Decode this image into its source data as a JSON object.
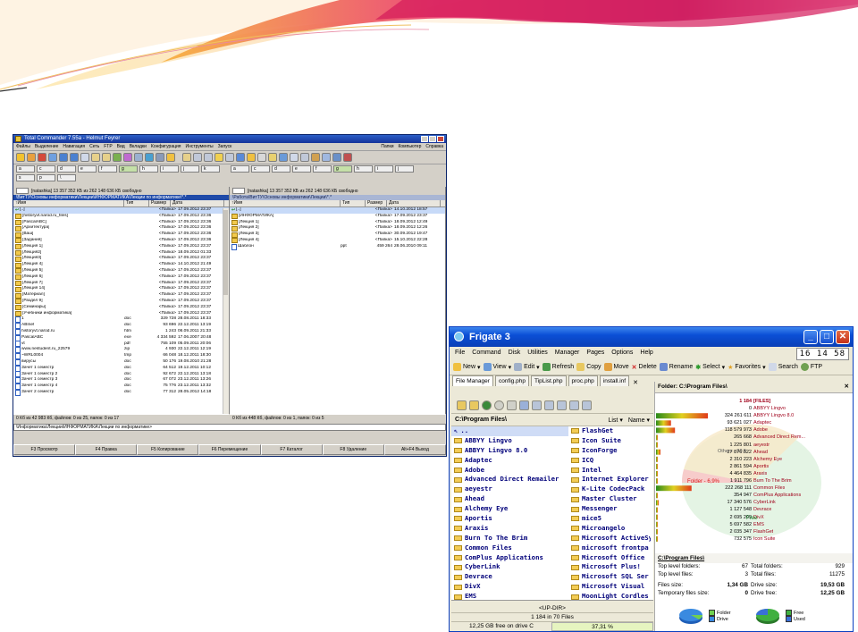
{
  "total_commander": {
    "title": "Total Commander 7.55a - Helmut Feyrer",
    "menu": [
      "Файлы",
      "Выделение",
      "Навигация",
      "Сеть",
      "FTP",
      "Вид",
      "Вкладки",
      "Конфигурация",
      "Инструменты",
      "Запуск"
    ],
    "menu_right": [
      "Папки",
      "Компьютер",
      "Справка"
    ],
    "left_panel": {
      "drive_info": "[natashka]  13 357 352 КБ из 262 148 636 КБ свободно",
      "path": "\\ВитТУ\\Основы информатики\\Лекции\\ИНФОРМАТИКА\\Лекции по информатике\\*.*",
      "headers": {
        "name": "↑Имя",
        "ext": "Тип",
        "size": "Размер",
        "date": "Дата"
      },
      "rows": [
        {
          "name": "[..]",
          "ext": "",
          "size": "<Папка>",
          "date": "17.09.2012 23:37",
          "kind": "up"
        },
        {
          "name": "[historyvt.narod.ru_files]",
          "ext": "",
          "size": "<Папка>",
          "date": "17.09.2012 23:36",
          "kind": "folder"
        },
        {
          "name": "[PascalABC]",
          "ext": "",
          "size": "<Папка>",
          "date": "17.09.2012 23:36",
          "kind": "folder"
        },
        {
          "name": "[Архитектура]",
          "ext": "",
          "size": "<Папка>",
          "date": "17.09.2012 23:36",
          "kind": "folder"
        },
        {
          "name": "[Ваш]",
          "ext": "",
          "size": "<Папка>",
          "date": "17.09.2012 23:36",
          "kind": "folder"
        },
        {
          "name": "[Задания]",
          "ext": "",
          "size": "<Папка>",
          "date": "17.09.2012 23:36",
          "kind": "folder"
        },
        {
          "name": "[Лекция 1]",
          "ext": "",
          "size": "<Папка>",
          "date": "17.09.2012 23:37",
          "kind": "folder"
        },
        {
          "name": "[Лекция2]",
          "ext": "",
          "size": "<Папка>",
          "date": "18.09.2012 01:33",
          "kind": "folder"
        },
        {
          "name": "[Лекция3]",
          "ext": "",
          "size": "<Папка>",
          "date": "17.09.2012 23:37",
          "kind": "folder"
        },
        {
          "name": "[Лекция 4]",
          "ext": "",
          "size": "<Папка>",
          "date": "14.10.2012 21:49",
          "kind": "folder"
        },
        {
          "name": "[Лекция 5]",
          "ext": "",
          "size": "<Папка>",
          "date": "17.09.2012 23:37",
          "kind": "folder"
        },
        {
          "name": "[Лекция 6]",
          "ext": "",
          "size": "<Папка>",
          "date": "17.09.2012 23:37",
          "kind": "folder"
        },
        {
          "name": "[Лекция 7]",
          "ext": "",
          "size": "<Папка>",
          "date": "17.09.2012 23:37",
          "kind": "folder"
        },
        {
          "name": "[Лекция 14]",
          "ext": "",
          "size": "<Папка>",
          "date": "17.09.2012 23:37",
          "kind": "folder"
        },
        {
          "name": "[Материал]",
          "ext": "",
          "size": "<Папка>",
          "date": "17.09.2012 23:37",
          "kind": "folder"
        },
        {
          "name": "[Раздел 9]",
          "ext": "",
          "size": "<Папка>",
          "date": "17.09.2012 23:37",
          "kind": "folder"
        },
        {
          "name": "[Семинары]",
          "ext": "",
          "size": "<Папка>",
          "date": "17.09.2012 23:37",
          "kind": "folder"
        },
        {
          "name": "[Учебники информатика]",
          "ext": "",
          "size": "<Папка>",
          "date": "17.09.2012 23:37",
          "kind": "folder"
        },
        {
          "name": "1",
          "ext": "doc",
          "size": "329 728",
          "date": "28.08.2011 18:33",
          "kind": "file"
        },
        {
          "name": "ABInet",
          "ext": "doc",
          "size": "93 696",
          "date": "22.12.2011 13:19",
          "kind": "file"
        },
        {
          "name": "historyvt.narod.ru",
          "ext": "htm",
          "size": "1 243",
          "date": "06.09.2011 21:33",
          "kind": "file"
        },
        {
          "name": "PascalABC",
          "ext": "exe",
          "size": "4 334 592",
          "date": "17.06.2007 20:48",
          "kind": "file"
        },
        {
          "name": "vt",
          "ext": "pdf",
          "size": "755 109",
          "date": "05.09.2011 20:06",
          "kind": "file"
        },
        {
          "name": "www.nestudent.ru_22579",
          "ext": "zip",
          "size": "4 930",
          "date": "22.12.2011 12:19",
          "kind": "file"
        },
        {
          "name": "~WRL0004",
          "ext": "tmp",
          "size": "66 048",
          "date": "18.12.2011 18:30",
          "kind": "file"
        },
        {
          "name": "вирусы",
          "ext": "doc",
          "size": "50 176",
          "date": "19.08.2010 21:28",
          "kind": "file"
        },
        {
          "name": "Зачет 1 семестр",
          "ext": "doc",
          "size": "64 512",
          "date": "19.12.2011 10:12",
          "kind": "file"
        },
        {
          "name": "Зачет 1 семестр 2",
          "ext": "doc",
          "size": "92 672",
          "date": "22.12.2011 13:18",
          "kind": "file"
        },
        {
          "name": "Зачет 1 семестр 3",
          "ext": "doc",
          "size": "67 072",
          "date": "23.12.2011 13:26",
          "kind": "file"
        },
        {
          "name": "Зачет 1 семестр 4",
          "ext": "doc",
          "size": "75 776",
          "date": "23.12.2011 13:32",
          "kind": "file"
        },
        {
          "name": "Зачет 2 семестр",
          "ext": "doc",
          "size": "77 312",
          "date": "28.05.2012 14:18",
          "kind": "file"
        }
      ],
      "status": "0 Кб из 42 983 Кб, файлов: 0 из 25, папок: 0 из 17"
    },
    "right_panel": {
      "drive_info": "[natashka]  13 357 352 КБ из 262 148 636 КБ свободно",
      "path": "\\Работа\\ВитТУ\\Основы информатики\\Лекции\\*.*",
      "headers": {
        "name": "↑Имя",
        "ext": "Тип",
        "size": "Размер",
        "date": "Дата"
      },
      "rows": [
        {
          "name": "[..]",
          "ext": "",
          "size": "<Папка>",
          "date": "14.10.2012 18:57",
          "kind": "up"
        },
        {
          "name": "[ИНФОРМАТИКА]",
          "ext": "",
          "size": "<Папка>",
          "date": "17.09.2012 23:37",
          "kind": "folder"
        },
        {
          "name": "[Лекция 1]",
          "ext": "",
          "size": "<Папка>",
          "date": "18.09.2012 12:49",
          "kind": "folder"
        },
        {
          "name": "[Лекция 2]",
          "ext": "",
          "size": "<Папка>",
          "date": "18.09.2012 12:26",
          "kind": "folder"
        },
        {
          "name": "[Лекция 3]",
          "ext": "",
          "size": "<Папка>",
          "date": "30.09.2012 19:47",
          "kind": "folder"
        },
        {
          "name": "[Лекция 4]",
          "ext": "",
          "size": "<Папка>",
          "date": "15.10.2012 22:28",
          "kind": "folder"
        },
        {
          "name": "Шаблон",
          "ext": "ppt",
          "size": "459 264",
          "date": "28.06.2010 09:11",
          "kind": "file"
        }
      ],
      "status": "0 Кб из 448 Кб, файлов: 0 из 1, папок: 0 из 5"
    },
    "command_line": "\\Информатика\\Лекции\\ИНФОРМАТИКА\\Лекции по информатике>",
    "fkeys": [
      "F3 Просмотр",
      "F4 Правка",
      "F5 Копирование",
      "F6 Перемещение",
      "F7 Каталог",
      "F8 Удаление",
      "Alt+F4 Выход"
    ]
  },
  "frigate": {
    "title": "Frigate 3",
    "clock": "16 14 58",
    "menu": [
      "File",
      "Command",
      "Disk",
      "Utilities",
      "Manager",
      "Pages",
      "Options",
      "Help"
    ],
    "toolbar": [
      "New",
      "View",
      "Edit",
      "Refresh",
      "Copy",
      "Move",
      "Delete",
      "Rename",
      "Select",
      "Favorites",
      "Search",
      "FTP"
    ],
    "tabs": [
      "File Manager",
      "config.php",
      "TipList.php",
      "proc.php",
      "install.inf"
    ],
    "left_path": "C:\\Program Files\\",
    "view_mode": "List",
    "sort_mode": "Name",
    "col1": [
      "..",
      "ABBYY Lingvo",
      "ABBYY Lingvo 8.0",
      "Adaptec",
      "Adobe",
      "Advanced Direct Remailer",
      "aeyestr",
      "Ahead",
      "Alchemy Eye",
      "Aportis",
      "Araxis",
      "Burn To The Brim",
      "Common Files",
      "ComPlus Applications",
      "CyberLink",
      "Devrace",
      "DivX",
      "EMS"
    ],
    "col2": [
      "FlashGet",
      "Icon Suite",
      "IconForge",
      "ICQ",
      "Intel",
      "Internet Explorer",
      "K-Lite CodecPack",
      "Master Cluster",
      "Messenger",
      "mice5",
      "Microangelo",
      "Microsoft ActiveSy",
      "microsoft frontpa",
      "Microsoft Office",
      "Microsoft Plus!",
      "Microsoft SQL Ser",
      "Microsoft Visual",
      "MoonLight Cordles"
    ],
    "bottom": {
      "updir": "<UP-DIR>",
      "files": "1 184 in 70 Files",
      "free": "12,25 GB free on drive C",
      "percent": "37,31 %"
    },
    "right_header": "Folder: C:\\Program Files\\",
    "right_rows": [
      {
        "n": "1 184",
        "l": "[FILES]"
      },
      {
        "n": "0",
        "l": "ABBYY Lingvo"
      },
      {
        "n": "324 261 611",
        "l": "ABBYY Lingvo 8.0"
      },
      {
        "n": "93 621 027",
        "l": "Adaptec"
      },
      {
        "n": "118 579 973",
        "l": "Adobe"
      },
      {
        "n": "265 668",
        "l": "Advanced Direct Rem..."
      },
      {
        "n": "1 225 801",
        "l": "aeyestr"
      },
      {
        "n": "27 876 522",
        "l": "Ahead"
      },
      {
        "n": "2 310 223",
        "l": "Alchemy Eye"
      },
      {
        "n": "2 861 594",
        "l": "Aportis"
      },
      {
        "n": "4 464 835",
        "l": "Araxis"
      },
      {
        "n": "1 911 796",
        "l": "Burn To The Brim"
      },
      {
        "n": "222 268 111",
        "l": "Common Files"
      },
      {
        "n": "354 947",
        "l": "ComPlus Applications"
      },
      {
        "n": "17 340 576",
        "l": "CyberLink"
      },
      {
        "n": "1 127 548",
        "l": "Devrace"
      },
      {
        "n": "2 695 209",
        "l": "DivX"
      },
      {
        "n": "5 697 582",
        "l": "EMS"
      },
      {
        "n": "2 035 347",
        "l": "FlashGet"
      },
      {
        "n": "732 575",
        "l": "Icon Suite"
      }
    ],
    "pie_labels": {
      "others": "Others - 30,5",
      "folder": "Folder - 6,9%",
      "free": "Free"
    },
    "info": {
      "title": "C:\\Program Files\\",
      "top_folders_l": "Top level folders:",
      "top_folders_v": "67",
      "total_folders_l": "Total folders:",
      "total_folders_v": "929",
      "top_files_l": "Top level files:",
      "top_files_v": "3",
      "total_files_l": "Total files:",
      "total_files_v": "11275",
      "files_size_l": "Files size:",
      "files_size_v": "1,34 GB",
      "drive_size_l": "Drive size:",
      "drive_size_v": "19,53 GB",
      "temp_l": "Temporary files size:",
      "temp_v": "0",
      "drive_free_l": "Drive free:",
      "drive_free_v": "12,25 GB"
    },
    "legend1": [
      "Folder",
      "Drive"
    ],
    "legend2": [
      "Free",
      "Used"
    ]
  }
}
